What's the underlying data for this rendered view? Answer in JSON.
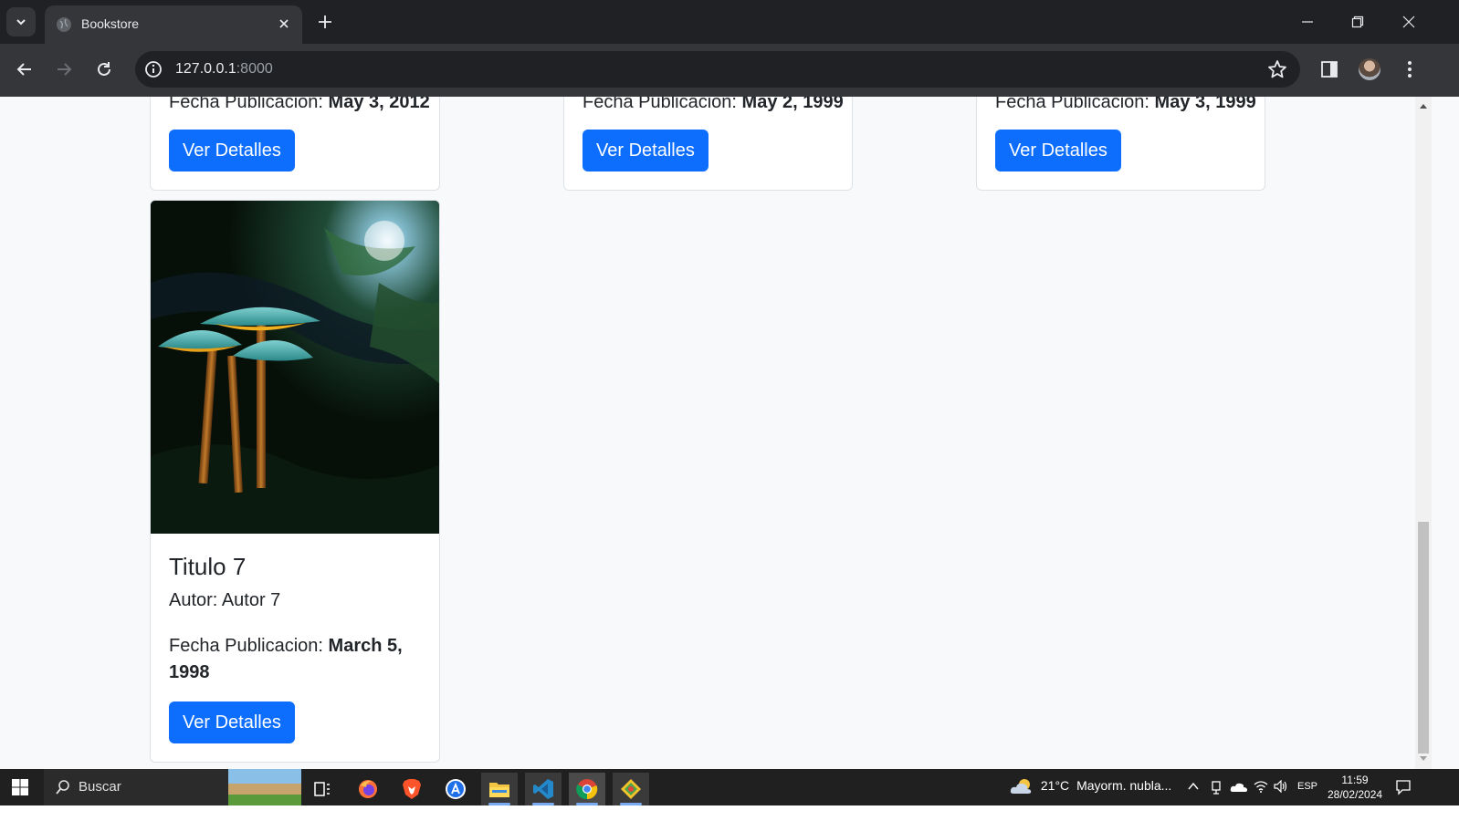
{
  "browser": {
    "tab_title": "Bookstore",
    "url_host": "127.0.0.1",
    "url_port": ":8000"
  },
  "cards_top": [
    {
      "date_label": "Fecha Publicacion:",
      "date_value": "May 3, 2012",
      "button": "Ver Detalles"
    },
    {
      "date_label": "Fecha Publicacion:",
      "date_value": "May 2, 1999",
      "button": "Ver Detalles"
    },
    {
      "date_label": "Fecha Publicacion:",
      "date_value": "May 3, 1999",
      "button": "Ver Detalles"
    }
  ],
  "card_main": {
    "title": "Titulo 7",
    "author_label": "Autor:",
    "author": "Autor 7",
    "date_label": "Fecha Publicacion:",
    "date_value": "March 5, 1998",
    "button": "Ver Detalles"
  },
  "taskbar": {
    "search_placeholder": "Buscar",
    "weather": "21°C",
    "weather_desc": "Mayorm. nubla...",
    "lang": "ESP",
    "time": "11:59",
    "date": "28/02/2024"
  },
  "colors": {
    "primary": "#0d6efd",
    "chrome_dark": "#202124",
    "chrome_toolbar": "#35363a"
  }
}
